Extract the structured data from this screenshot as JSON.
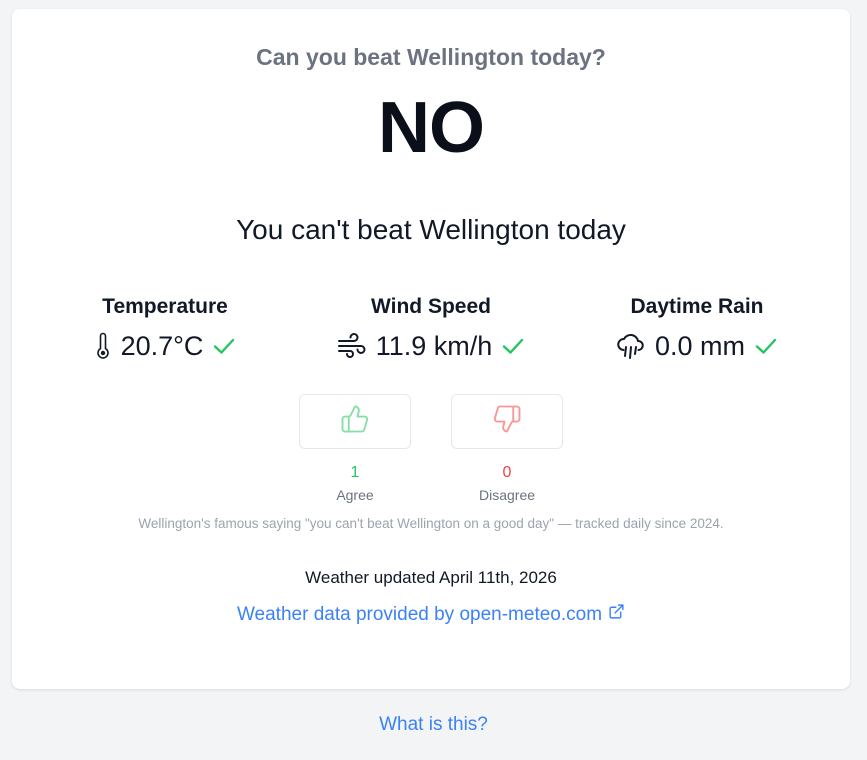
{
  "header": {
    "question": "Can you beat Wellington today?",
    "answer": "NO",
    "verdict": "You can't beat Wellington today"
  },
  "stats": [
    {
      "title": "Temperature",
      "value": "20.7°C",
      "icon": "thermometer-icon",
      "status": "check"
    },
    {
      "title": "Wind Speed",
      "value": "11.9 km/h",
      "icon": "wind-icon",
      "status": "check"
    },
    {
      "title": "Daytime Rain",
      "value": "0.0 mm",
      "icon": "rain-cloud-icon",
      "status": "check"
    }
  ],
  "votes": {
    "agree": {
      "count": "1",
      "label": "Agree",
      "icon": "thumbs-up-icon",
      "color": "#22c55e"
    },
    "disagree": {
      "count": "0",
      "label": "Disagree",
      "icon": "thumbs-down-icon",
      "color": "#ef4444"
    }
  },
  "saying": "Wellington's famous saying \"you can't beat Wellington on a good day\" — tracked daily since 2024.",
  "updated": "Weather updated April 11th, 2026",
  "source": {
    "label": "Weather data provided by open-meteo.com",
    "icon": "external-link-icon"
  },
  "footer": {
    "link_label": "What is this?"
  },
  "colors": {
    "accent": "#3b82f6",
    "check": "#22c55e",
    "muted": "#6b7280"
  }
}
